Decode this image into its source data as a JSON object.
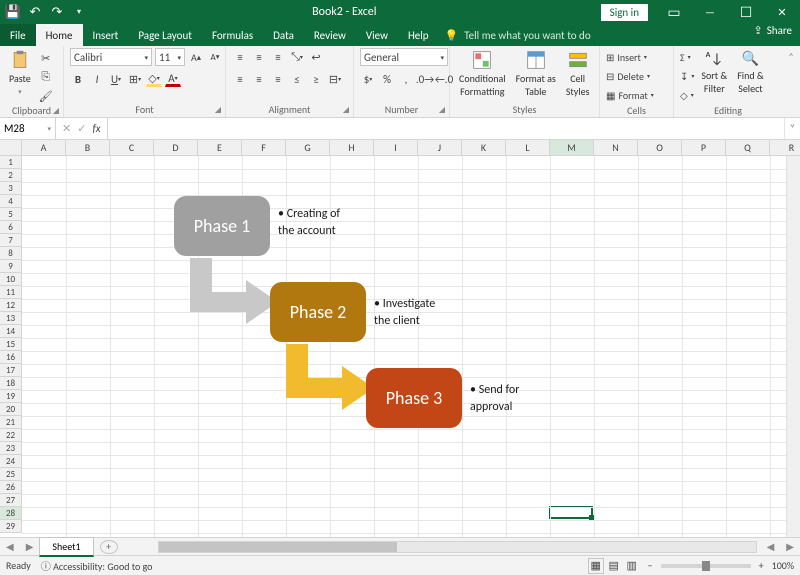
{
  "titlebar": {
    "title": "Book2 - Excel",
    "signin": "Sign in"
  },
  "tabs": {
    "file": "File",
    "home": "Home",
    "insert": "Insert",
    "pagelayout": "Page Layout",
    "formulas": "Formulas",
    "data": "Data",
    "review": "Review",
    "view": "View",
    "help": "Help",
    "tellme": "Tell me what you want to do",
    "share": "Share"
  },
  "ribbon": {
    "clipboard": {
      "label": "Clipboard",
      "paste": "Paste"
    },
    "font": {
      "label": "Font",
      "name": "Calibri",
      "size": "11"
    },
    "alignment": {
      "label": "Alignment"
    },
    "number": {
      "label": "Number",
      "format": "General"
    },
    "styles": {
      "label": "Styles",
      "cond": "Conditional\nFormatting",
      "table": "Format as\nTable",
      "cell": "Cell\nStyles"
    },
    "cells": {
      "label": "Cells",
      "insert": "Insert",
      "delete": "Delete",
      "format": "Format"
    },
    "editing": {
      "label": "Editing",
      "sort": "Sort &\nFilter",
      "find": "Find &\nSelect"
    }
  },
  "namebox": "M28",
  "columns": [
    "A",
    "B",
    "C",
    "D",
    "E",
    "F",
    "G",
    "H",
    "I",
    "J",
    "K",
    "L",
    "M",
    "N",
    "O",
    "P",
    "Q",
    "R"
  ],
  "rows": [
    "1",
    "2",
    "3",
    "4",
    "5",
    "6",
    "7",
    "8",
    "9",
    "10",
    "11",
    "12",
    "13",
    "14",
    "15",
    "16",
    "17",
    "18",
    "19",
    "20",
    "21",
    "22",
    "23",
    "24",
    "25",
    "26",
    "27",
    "28",
    "29"
  ],
  "selected": {
    "col": "M",
    "row": "28"
  },
  "smartart": {
    "phase1": {
      "title": "Phase 1",
      "bullet": "Creating of the account"
    },
    "phase2": {
      "title": "Phase 2",
      "bullet": "Investigate the client"
    },
    "phase3": {
      "title": "Phase 3",
      "bullet": "Send for approval"
    }
  },
  "sheet": {
    "name": "Sheet1"
  },
  "status": {
    "ready": "Ready",
    "access": "Accessibility: Good to go",
    "zoom": "100%"
  }
}
